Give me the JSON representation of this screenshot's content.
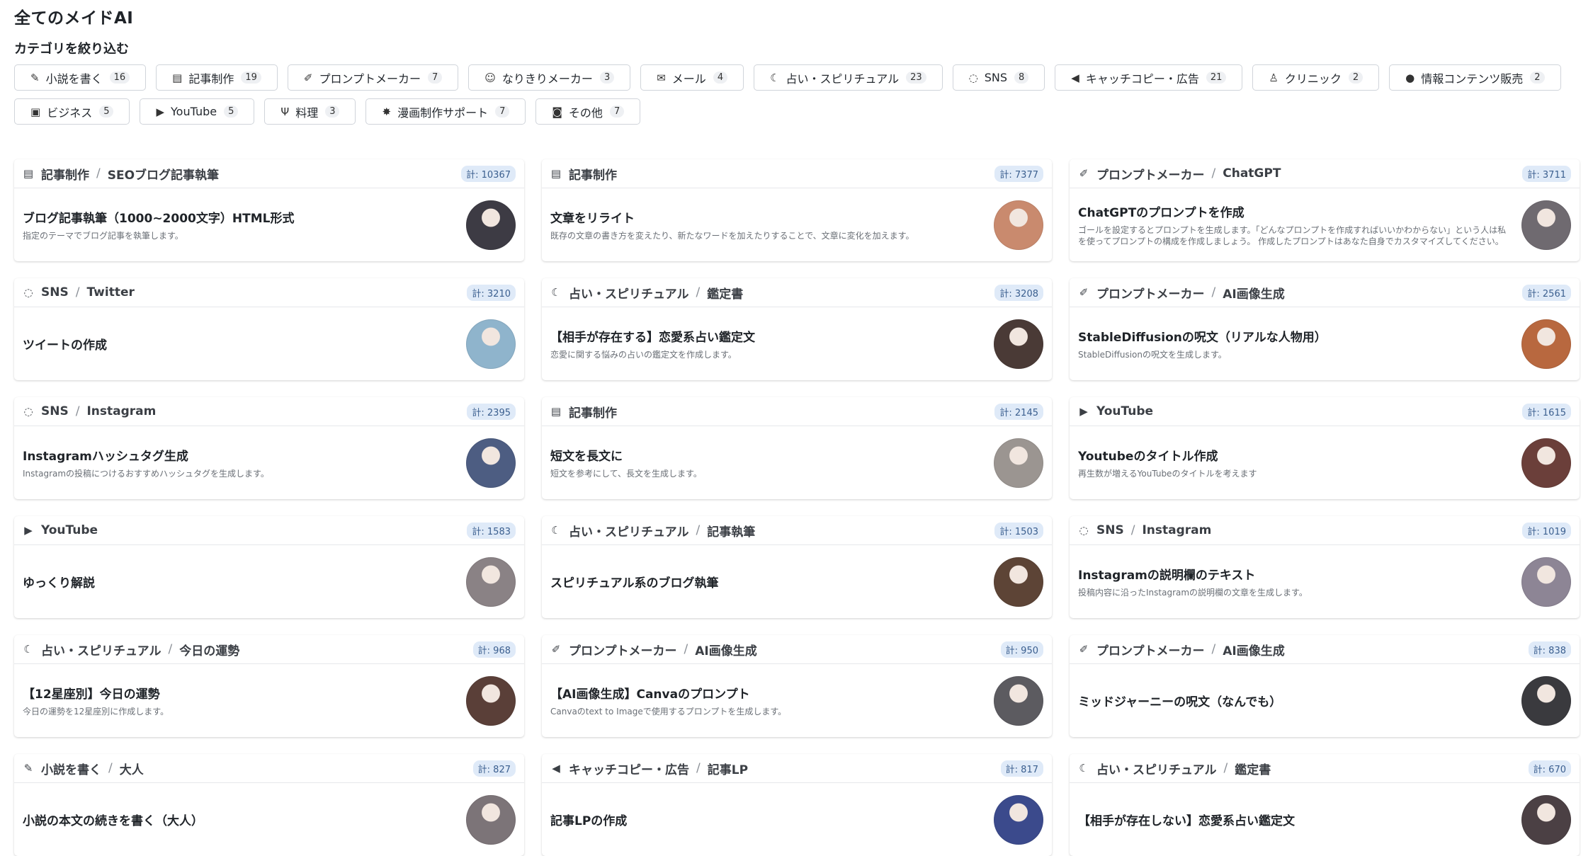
{
  "page": {
    "title": "全てのメイドAI",
    "filter_label": "カテゴリを絞り込む"
  },
  "categories": [
    {
      "label": "小説を書く",
      "count": "16",
      "icon": "pen-icon",
      "glyph": "✎"
    },
    {
      "label": "記事制作",
      "count": "19",
      "icon": "book-icon",
      "glyph": "▤"
    },
    {
      "label": "プロンプトメーカー",
      "count": "7",
      "icon": "brush-icon",
      "glyph": "✐"
    },
    {
      "label": "なりきりメーカー",
      "count": "3",
      "icon": "masks-icon",
      "glyph": "☺"
    },
    {
      "label": "メール",
      "count": "4",
      "icon": "envelope-icon",
      "glyph": "✉"
    },
    {
      "label": "占い・スピリチュアル",
      "count": "23",
      "icon": "moon-icon",
      "glyph": "☾"
    },
    {
      "label": "SNS",
      "count": "8",
      "icon": "speech-bubble-icon",
      "glyph": "◌"
    },
    {
      "label": "キャッチコピー・広告",
      "count": "21",
      "icon": "megaphone-icon",
      "glyph": "◀"
    },
    {
      "label": "クリニック",
      "count": "2",
      "icon": "doctor-icon",
      "glyph": "♙"
    },
    {
      "label": "情報コンテンツ販売",
      "count": "2",
      "icon": "lightbulb-icon",
      "glyph": "●"
    },
    {
      "label": "ビジネス",
      "count": "5",
      "icon": "briefcase-icon",
      "glyph": "▣"
    },
    {
      "label": "YouTube",
      "count": "5",
      "icon": "youtube-icon",
      "glyph": "▶"
    },
    {
      "label": "料理",
      "count": "3",
      "icon": "utensils-icon",
      "glyph": "Ψ"
    },
    {
      "label": "漫画制作サポート",
      "count": "7",
      "icon": "burst-icon",
      "glyph": "✸"
    },
    {
      "label": "その他",
      "count": "7",
      "icon": "robot-icon",
      "glyph": "◙"
    }
  ],
  "cards": [
    {
      "category": "記事制作",
      "sub": "SEOブログ記事執筆",
      "stat": "計: 10367",
      "title": "ブログ記事執筆（1000~2000文字）HTML形式",
      "desc": "指定のテーマでブログ記事を執筆します。",
      "icon": "book-icon",
      "glyph": "▤",
      "avatar_color": "#3d3b44"
    },
    {
      "category": "記事制作",
      "sub": "",
      "stat": "計: 7377",
      "title": "文章をリライト",
      "desc": "既存の文章の書き方を変えたり、新たなワードを加えたりすることで、文章に変化を加えます。",
      "icon": "book-icon",
      "glyph": "▤",
      "avatar_color": "#c98a6e"
    },
    {
      "category": "プロンプトメーカー",
      "sub": "ChatGPT",
      "stat": "計: 3711",
      "title": "ChatGPTのプロンプトを作成",
      "desc": "ゴールを設定するとプロンプトを生成します。「どんなプロンプトを作成すればいいかわからない」という人は私を使ってプロンプトの構成を作成しましょう。 作成したプロンプトはあなた自身でカスタマイズしてください。",
      "icon": "brush-icon",
      "glyph": "✐",
      "avatar_color": "#6f6a70"
    },
    {
      "category": "SNS",
      "sub": "Twitter",
      "stat": "計: 3210",
      "title": "ツイートの作成",
      "desc": "",
      "icon": "speech-bubble-icon",
      "glyph": "◌",
      "avatar_color": "#8fb4cc"
    },
    {
      "category": "占い・スピリチュアル",
      "sub": "鑑定書",
      "stat": "計: 3208",
      "title": "【相手が存在する】恋愛系占い鑑定文",
      "desc": "恋愛に関する悩みの占いの鑑定文を作成します。",
      "icon": "moon-icon",
      "glyph": "☾",
      "avatar_color": "#4a3a36"
    },
    {
      "category": "プロンプトメーカー",
      "sub": "AI画像生成",
      "stat": "計: 2561",
      "title": "StableDiffusionの呪文（リアルな人物用）",
      "desc": "StableDiffusionの呪文を生成します。",
      "icon": "brush-icon",
      "glyph": "✐",
      "avatar_color": "#b8683f"
    },
    {
      "category": "SNS",
      "sub": "Instagram",
      "stat": "計: 2395",
      "title": "Instagramハッシュタグ生成",
      "desc": "Instagramの投稿につけるおすすめハッシュタグを生成します。",
      "icon": "speech-bubble-icon",
      "glyph": "◌",
      "avatar_color": "#4d5d82"
    },
    {
      "category": "記事制作",
      "sub": "",
      "stat": "計: 2145",
      "title": "短文を長文に",
      "desc": "短文を参考にして、長文を生成します。",
      "icon": "book-icon",
      "glyph": "▤",
      "avatar_color": "#9b9591"
    },
    {
      "category": "YouTube",
      "sub": "",
      "stat": "計: 1615",
      "title": "Youtubeのタイトル作成",
      "desc": "再生数が増えるYouTubeのタイトルを考えます",
      "icon": "youtube-icon",
      "glyph": "▶",
      "avatar_color": "#6b3f3a"
    },
    {
      "category": "YouTube",
      "sub": "",
      "stat": "計: 1583",
      "title": "ゆっくり解説",
      "desc": "",
      "icon": "youtube-icon",
      "glyph": "▶",
      "avatar_color": "#8a8285"
    },
    {
      "category": "占い・スピリチュアル",
      "sub": "記事執筆",
      "stat": "計: 1503",
      "title": "スピリチュアル系のブログ執筆",
      "desc": "",
      "icon": "moon-icon",
      "glyph": "☾",
      "avatar_color": "#5d4436"
    },
    {
      "category": "SNS",
      "sub": "Instagram",
      "stat": "計: 1019",
      "title": "Instagramの説明欄のテキスト",
      "desc": "投稿内容に沿ったInstagramの説明欄の文章を生成します。",
      "icon": "speech-bubble-icon",
      "glyph": "◌",
      "avatar_color": "#8d8595"
    },
    {
      "category": "占い・スピリチュアル",
      "sub": "今日の運勢",
      "stat": "計: 968",
      "title": "【12星座別】今日の運勢",
      "desc": "今日の運勢を12星座別に作成します。",
      "icon": "moon-icon",
      "glyph": "☾",
      "avatar_color": "#5a3f38"
    },
    {
      "category": "プロンプトメーカー",
      "sub": "AI画像生成",
      "stat": "計: 950",
      "title": "【AI画像生成】Canvaのプロンプト",
      "desc": "Canvaのtext to Imageで使用するプロンプトを生成します。",
      "icon": "brush-icon",
      "glyph": "✐",
      "avatar_color": "#5c5b60"
    },
    {
      "category": "プロンプトメーカー",
      "sub": "AI画像生成",
      "stat": "計: 838",
      "title": "ミッドジャーニーの呪文（なんでも）",
      "desc": "",
      "icon": "brush-icon",
      "glyph": "✐",
      "avatar_color": "#3a3a3e"
    },
    {
      "category": "小説を書く",
      "sub": "大人",
      "stat": "計: 827",
      "title": "小説の本文の続きを書く（大人）",
      "desc": "",
      "icon": "pen-icon",
      "glyph": "✎",
      "avatar_color": "#7c7478"
    },
    {
      "category": "キャッチコピー・広告",
      "sub": "記事LP",
      "stat": "計: 817",
      "title": "記事LPの作成",
      "desc": "",
      "icon": "megaphone-icon",
      "glyph": "◀",
      "avatar_color": "#3b4a8c"
    },
    {
      "category": "占い・スピリチュアル",
      "sub": "鑑定書",
      "stat": "計: 670",
      "title": "【相手が存在しない】恋愛系占い鑑定文",
      "desc": "",
      "icon": "moon-icon",
      "glyph": "☾",
      "avatar_color": "#4b4044"
    }
  ]
}
